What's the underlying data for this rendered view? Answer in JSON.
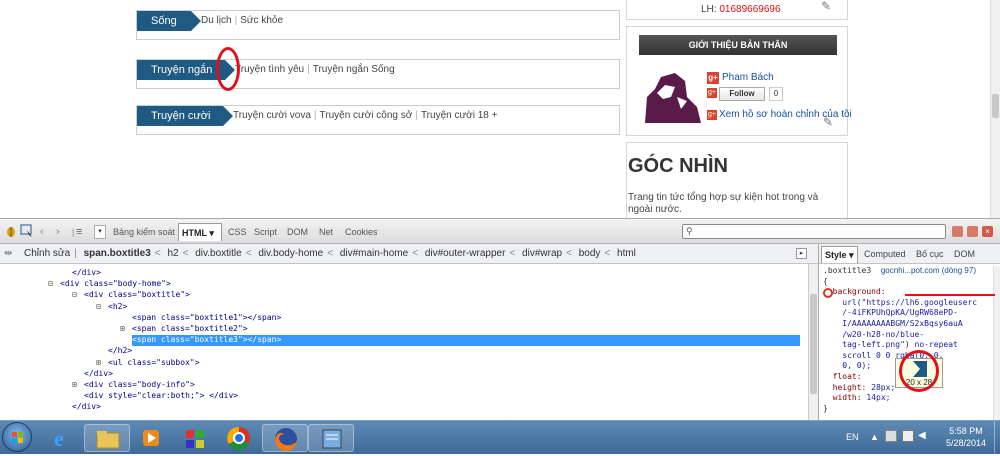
{
  "web": {
    "categories": [
      {
        "title": "Sống",
        "links": [
          "Du lịch",
          "Sức khỏe"
        ]
      },
      {
        "title": "Truyện ngắn",
        "links": [
          "Truyện tình yêu",
          "Truyện ngắn Sống"
        ]
      },
      {
        "title": "Truyện cười",
        "links": [
          "Truyện cười vova",
          "Truyện cười công sở",
          "Truyện cười 18 +"
        ]
      }
    ],
    "contact": "LH: ",
    "phone": "01689669696",
    "about_title": "GIỚI THIỆU BẢN THÂN",
    "profile_name": "Pham Bách",
    "follow_label": "Follow",
    "follow_count": "0",
    "profile_link": "Xem hồ sơ hoàn chỉnh của tôi",
    "gocnhin_title": "GÓC NHÌN",
    "gocnhin_desc": "Trang tin tức tổng hợp sự kiện hot trong và ngoài nước."
  },
  "firebug": {
    "tabs": [
      "Bảng kiểm soát",
      "HTML",
      "CSS",
      "Script",
      "DOM",
      "Net",
      "Cookies"
    ],
    "selected_tab": "HTML",
    "edit_label": "Chỉnh sửa",
    "breadcrumb": [
      "span.boxtitle3",
      "h2",
      "div.boxtitle",
      "div.body-home",
      "div#main-home",
      "div#outer-wrapper",
      "div#wrap",
      "body",
      "html"
    ],
    "html_lines": [
      {
        "indent": 12,
        "text": "</div>",
        "toggle": ""
      },
      {
        "indent": 10,
        "text": "<div class=\"body-home\">",
        "toggle": "−"
      },
      {
        "indent": 14,
        "text": "<div class=\"boxtitle\">",
        "toggle": "−"
      },
      {
        "indent": 18,
        "text": "<h2>",
        "toggle": "−"
      },
      {
        "indent": 22,
        "text": "<span class=\"boxtitle1\"></span>",
        "toggle": ""
      },
      {
        "indent": 22,
        "text": "<span class=\"boxtitle2\">",
        "toggle": "+"
      },
      {
        "indent": 22,
        "text": "<span class=\"boxtitle3\"></span>",
        "toggle": ""
      },
      {
        "indent": 18,
        "text": "</h2>",
        "toggle": ""
      },
      {
        "indent": 18,
        "text": "<ul class=\"subbox\">",
        "toggle": "+"
      },
      {
        "indent": 14,
        "text": "</div>",
        "toggle": ""
      },
      {
        "indent": 14,
        "text": "<div class=\"body-info\">",
        "toggle": "+"
      },
      {
        "indent": 14,
        "text": "<div style=\"clear:both;\"> </div>",
        "toggle": ""
      },
      {
        "indent": 12,
        "text": "</div>",
        "toggle": ""
      }
    ],
    "selected_line": 6,
    "side_tabs": [
      "Style",
      "Computed",
      "Bố cục",
      "DOM"
    ],
    "selected_side_tab": "Style",
    "css_selector": ".boxtitle3",
    "css_source": "gocnhi...pot.com (dòng 97)",
    "css_lines": [
      "{",
      "  background:",
      "    url(\"https://lh6.googleuserc",
      "    /-4iFKPUhQpKA/UgRW68ePD-",
      "    I/AAAAAAAABGM/S2xBqsy6auA",
      "    /w20-h28-no/blue-",
      "    tag-left.png\") no-repeat",
      "    scroll 0 0 rgba(0, 0,",
      "    0, 0);",
      "  float: ",
      "  height: 28px;",
      "  width: 14px;",
      "}"
    ],
    "tooltip_size": "20 x 28",
    "search_placeholder": ""
  },
  "taskbar": {
    "language": "EN",
    "time": "5:58 PM",
    "date": "5/28/2014"
  },
  "colors": {
    "accent_blue": "#1f5a82",
    "selection": "#3399ff",
    "annotation_red": "#e0111a"
  }
}
